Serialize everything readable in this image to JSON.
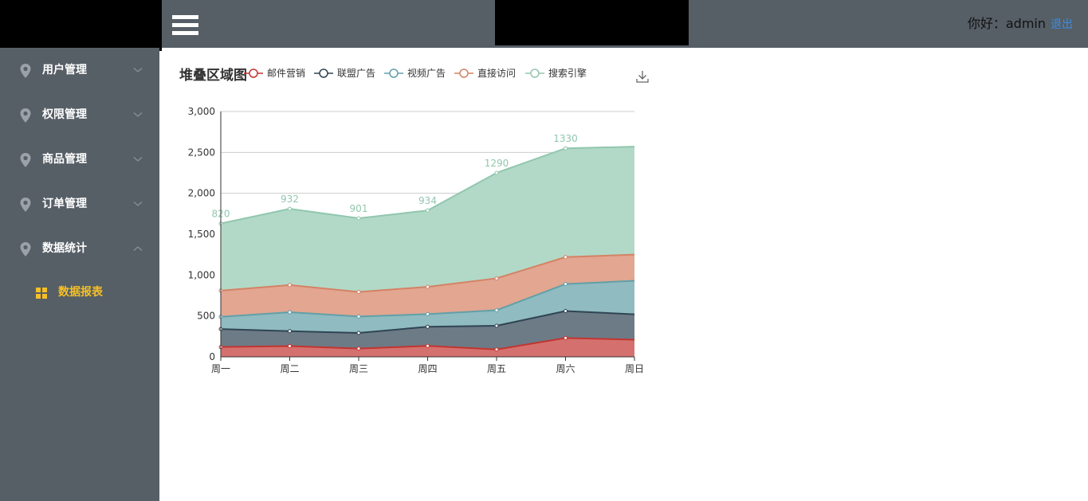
{
  "header": {
    "greeting": "你好：admin",
    "logout": "退出"
  },
  "sidebar": {
    "items": [
      {
        "label": "用户管理",
        "icon": "map-pin-icon",
        "expanded": false
      },
      {
        "label": "权限管理",
        "icon": "map-pin-icon",
        "expanded": false
      },
      {
        "label": "商品管理",
        "icon": "map-pin-icon",
        "expanded": false
      },
      {
        "label": "订单管理",
        "icon": "map-pin-icon",
        "expanded": false
      },
      {
        "label": "数据统计",
        "icon": "map-pin-icon",
        "expanded": true
      }
    ],
    "sub_item": {
      "label": "数据报表",
      "icon": "grid-icon",
      "active_color": "#f5c025"
    }
  },
  "colors": {
    "header_bg": "#565e66",
    "sidebar_bg": "#565e66",
    "link": "#3a8ee6"
  },
  "chart_data": {
    "type": "area",
    "title": "堆叠区域图",
    "stacked": true,
    "categories": [
      "周一",
      "周二",
      "周三",
      "周四",
      "周五",
      "周六",
      "周日"
    ],
    "ylim": [
      0,
      3000
    ],
    "yticks": [
      "0",
      "500",
      "1,000",
      "1,500",
      "2,000",
      "2,500",
      "3,000"
    ],
    "grid": true,
    "legend_position": "top",
    "series": [
      {
        "name": "邮件营销",
        "color": "#c23531",
        "fill": "#d4716e",
        "values": [
          120,
          132,
          101,
          134,
          90,
          230,
          210
        ]
      },
      {
        "name": "联盟广告",
        "color": "#2f4554",
        "fill": "#6d7b86",
        "values": [
          220,
          182,
          191,
          234,
          290,
          330,
          310
        ]
      },
      {
        "name": "视频广告",
        "color": "#61a0a8",
        "fill": "#90bbc0",
        "values": [
          150,
          232,
          201,
          154,
          190,
          330,
          410
        ]
      },
      {
        "name": "直接访问",
        "color": "#d48265",
        "fill": "#e2a691",
        "values": [
          320,
          332,
          301,
          334,
          390,
          330,
          320
        ]
      },
      {
        "name": "搜索引擎",
        "color": "#91c7ae",
        "fill": "#b2d9c7",
        "values": [
          820,
          932,
          901,
          934,
          1290,
          1330,
          1320
        ],
        "labels": true
      }
    ]
  }
}
